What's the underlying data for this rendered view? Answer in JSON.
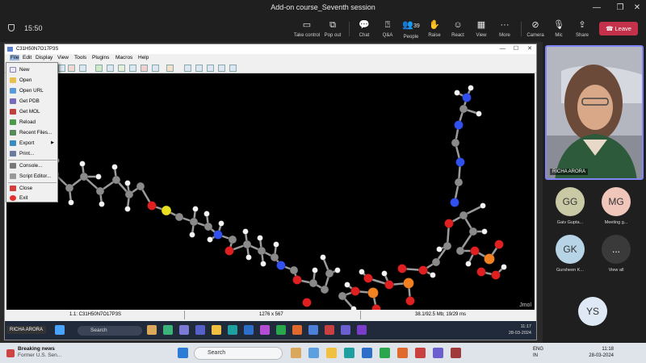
{
  "window": {
    "title": "Add-on course_Seventh session"
  },
  "meeting": {
    "timer": "15:50",
    "toolbar": [
      {
        "label": "Take control",
        "icon": "take-control-icon"
      },
      {
        "label": "Pop out",
        "icon": "pop-out-icon"
      },
      {
        "label": "Chat",
        "icon": "chat-icon"
      },
      {
        "label": "Q&A",
        "icon": "qa-icon"
      },
      {
        "label": "People",
        "icon": "people-icon",
        "count": "39"
      },
      {
        "label": "Raise",
        "icon": "raise-hand-icon"
      },
      {
        "label": "React",
        "icon": "react-icon"
      },
      {
        "label": "View",
        "icon": "view-icon"
      },
      {
        "label": "More",
        "icon": "more-icon"
      },
      {
        "label": "Camera",
        "icon": "camera-off-icon"
      },
      {
        "label": "Mic",
        "icon": "mic-off-icon"
      },
      {
        "label": "Share",
        "icon": "share-icon"
      }
    ],
    "leave_label": "Leave",
    "leave_color": "#c4314b"
  },
  "jmol": {
    "title": "C31H50N7O17P3S",
    "menus": [
      "File",
      "Edit",
      "Display",
      "View",
      "Tools",
      "Plugins",
      "Macros",
      "Help"
    ],
    "file_menu": [
      "New",
      "Open",
      "Open URL",
      "Get PDB",
      "Get MOL",
      "Reload",
      "Recent Files...",
      "Export",
      "Print...",
      "Console...",
      "Script Editor...",
      "Close",
      "Exit"
    ],
    "status": {
      "model": "1.1: C31H50N7O17P3S",
      "size": "1276 x 567",
      "fps": "38.1/92.5 Mb; 19/29 ms"
    },
    "watermark": "Jmol"
  },
  "inner_taskbar": {
    "presenter": "RICHA ARORA",
    "search_placeholder": "Search",
    "time": "11:17",
    "date": "28-03-2024"
  },
  "participants": {
    "speaker": "RICHA ARORA",
    "tiles": [
      {
        "initials": "GG",
        "name": "Gaiv Gupta...",
        "color": "#c9c9a6"
      },
      {
        "initials": "MG",
        "name": "Meeting g...",
        "color": "#f0c6bb"
      },
      {
        "initials": "GK",
        "name": "Gursheen K...",
        "color": "#b7d4e6"
      },
      {
        "initials": "...",
        "name": "View all",
        "color": "#3a3a3a"
      },
      {
        "initials": "YS",
        "name": "",
        "color": "#dfe9f5"
      }
    ]
  },
  "taskbar": {
    "news_title": "Breaking news",
    "news_sub": "Former U.S. Sen...",
    "search_placeholder": "Search",
    "lang": "ENG",
    "region": "IN",
    "time": "11:18",
    "date": "28-03-2024"
  }
}
